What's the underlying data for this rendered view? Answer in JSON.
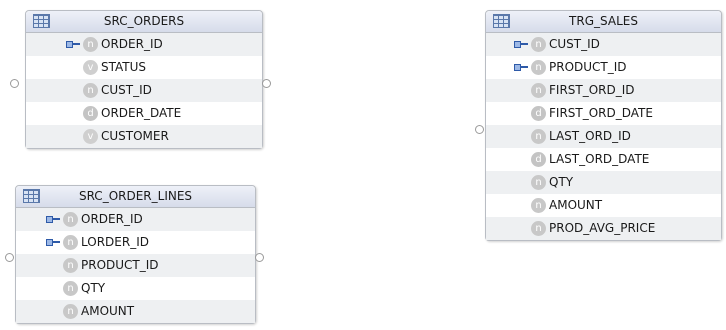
{
  "tables": [
    {
      "title": "SRC_ORDERS",
      "icon": "table-icon",
      "columns": [
        {
          "name": "ORDER_ID",
          "type": "n",
          "key": true
        },
        {
          "name": "STATUS",
          "type": "v",
          "key": false
        },
        {
          "name": "CUST_ID",
          "type": "n",
          "key": false
        },
        {
          "name": "ORDER_DATE",
          "type": "d",
          "key": false
        },
        {
          "name": "CUSTOMER",
          "type": "v",
          "key": false
        }
      ]
    },
    {
      "title": "SRC_ORDER_LINES",
      "icon": "table-icon",
      "columns": [
        {
          "name": "ORDER_ID",
          "type": "n",
          "key": true
        },
        {
          "name": "LORDER_ID",
          "type": "n",
          "key": true
        },
        {
          "name": "PRODUCT_ID",
          "type": "n",
          "key": false
        },
        {
          "name": "QTY",
          "type": "n",
          "key": false
        },
        {
          "name": "AMOUNT",
          "type": "n",
          "key": false
        }
      ]
    },
    {
      "title": "TRG_SALES",
      "icon": "table-icon",
      "columns": [
        {
          "name": "CUST_ID",
          "type": "n",
          "key": true
        },
        {
          "name": "PRODUCT_ID",
          "type": "n",
          "key": true
        },
        {
          "name": "FIRST_ORD_ID",
          "type": "n",
          "key": false
        },
        {
          "name": "FIRST_ORD_DATE",
          "type": "d",
          "key": false
        },
        {
          "name": "LAST_ORD_ID",
          "type": "n",
          "key": false
        },
        {
          "name": "LAST_ORD_DATE",
          "type": "d",
          "key": false
        },
        {
          "name": "QTY",
          "type": "n",
          "key": false
        },
        {
          "name": "AMOUNT",
          "type": "n",
          "key": false
        },
        {
          "name": "PROD_AVG_PRICE",
          "type": "n",
          "key": false
        }
      ]
    }
  ],
  "colors": {
    "header_top": "#eef1f8",
    "header_bottom": "#d6dcea",
    "border": "#b9bdc4",
    "alt_row": "#eef0f2",
    "key_blue": "#2e5aa8",
    "type_badge": "#c8c8c8"
  }
}
